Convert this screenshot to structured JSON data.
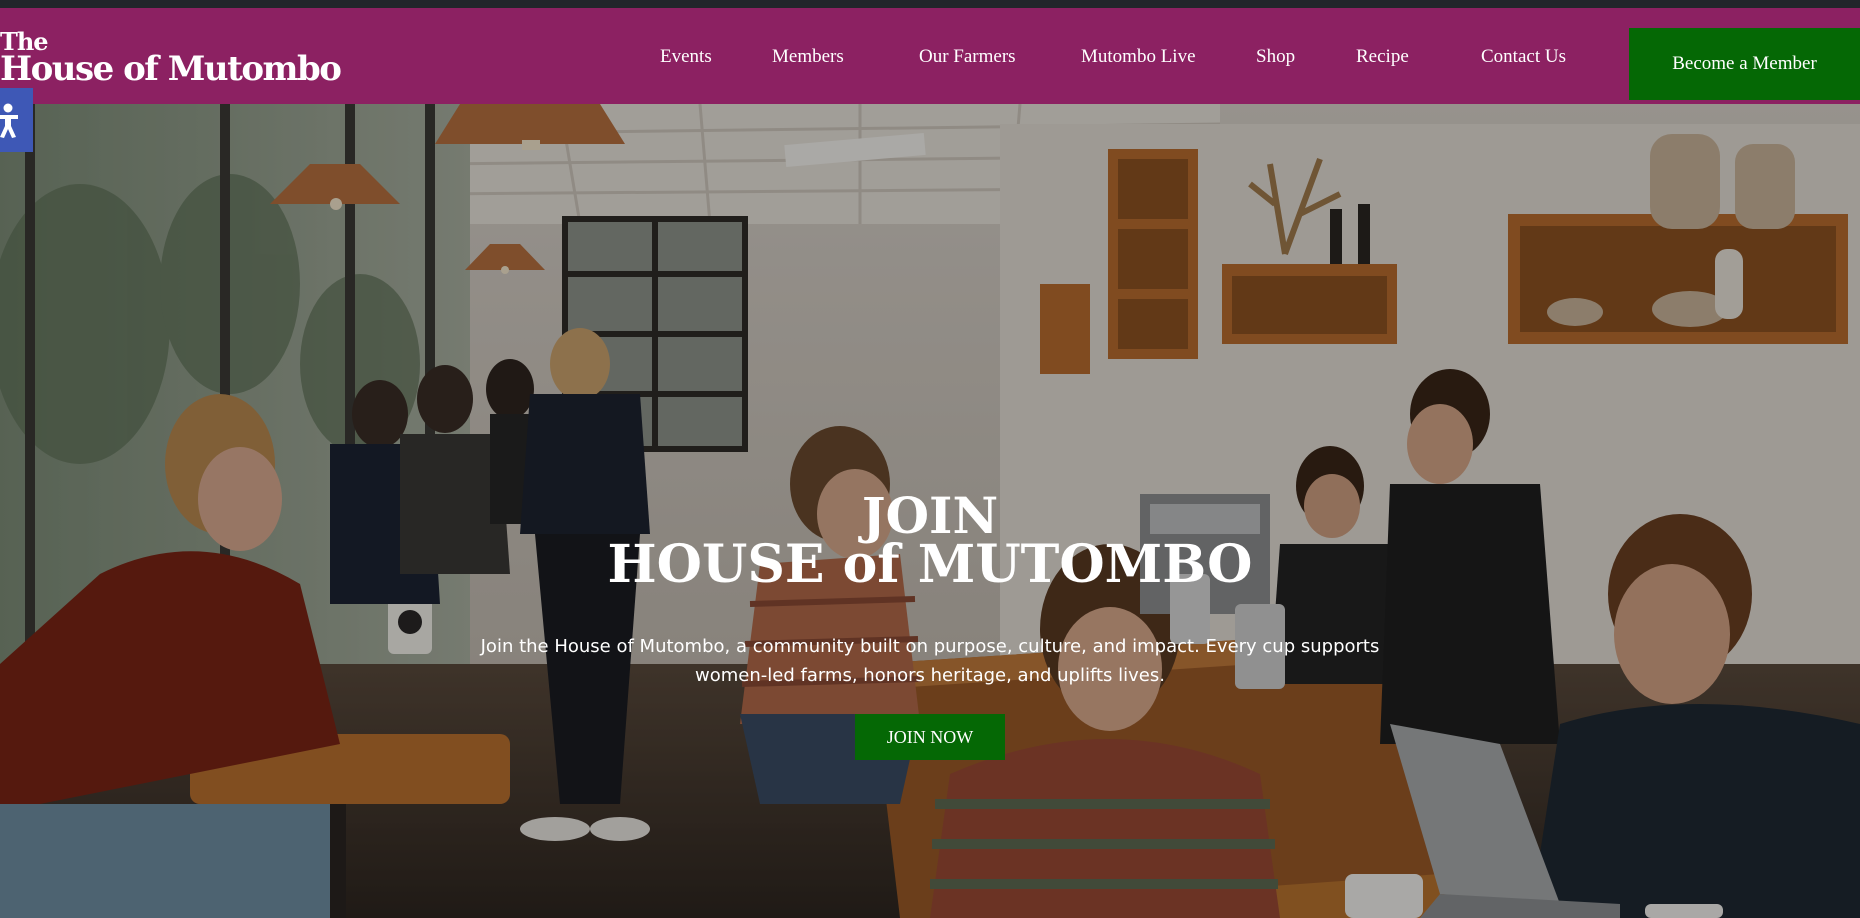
{
  "brand": {
    "logo_line1": "The",
    "logo_line2": "House of Mutombo"
  },
  "nav": {
    "items": [
      {
        "label": "Events"
      },
      {
        "label": "Members"
      },
      {
        "label": "Our Farmers"
      },
      {
        "label": "Mutombo Live"
      },
      {
        "label": "Shop"
      },
      {
        "label": "Recipe"
      },
      {
        "label": "Contact Us"
      }
    ],
    "cta_label": "Become a Member"
  },
  "accessibility": {
    "icon": "accessibility-icon"
  },
  "hero": {
    "title_line1": "JOIN",
    "title_line2": "HOUSE of MUTOMBO",
    "description": "Join the House of Mutombo, a community built on purpose, culture, and impact. Every cup supports women-led farms, honors heritage, and uplifts lives.",
    "button_label": "JOIN NOW",
    "background_image": "cafe-scene"
  },
  "colors": {
    "nav_bg": "#8c2162",
    "cta_green": "#056805",
    "accessibility_blue": "#3e58b6",
    "top_strip": "#22252b"
  }
}
